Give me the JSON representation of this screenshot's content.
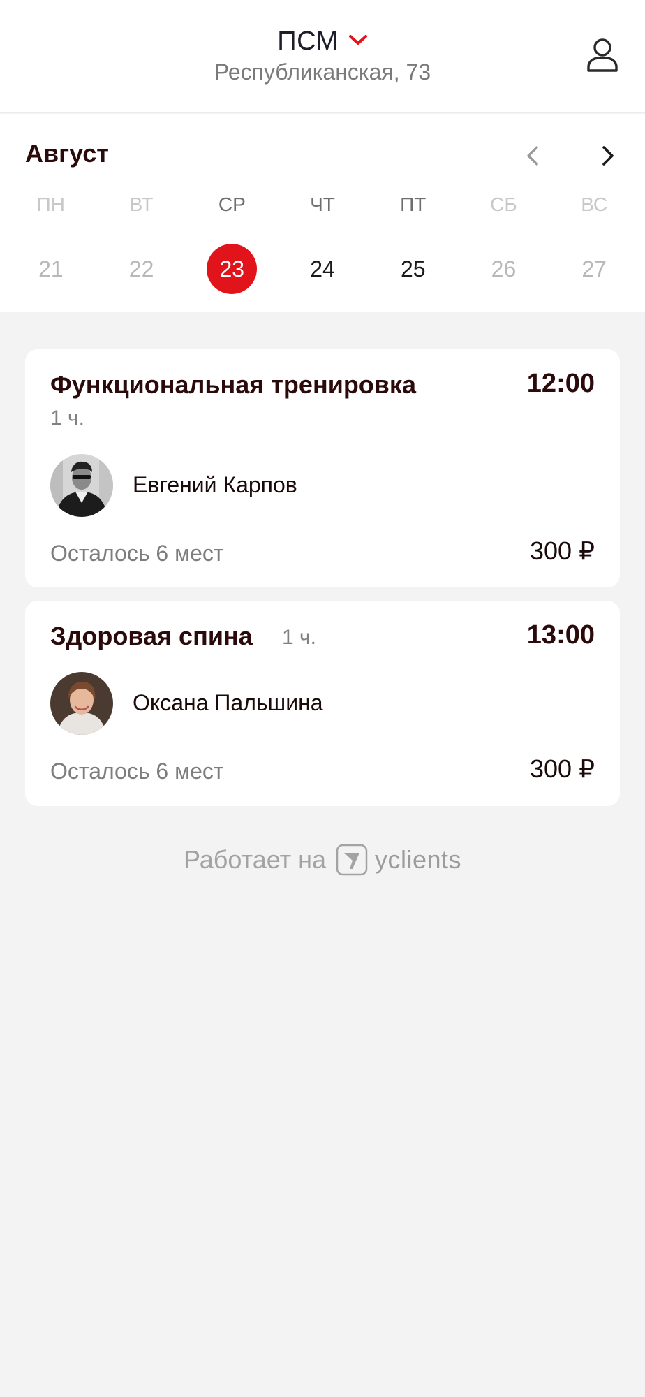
{
  "header": {
    "club_name": "ПСМ",
    "address": "Республиканская, 73",
    "icons": {
      "dropdown": "chevron-down-icon",
      "profile": "user-icon"
    },
    "accent_color": "#e2141b"
  },
  "calendar": {
    "month": "Август",
    "weekdays": [
      "ПН",
      "ВТ",
      "СР",
      "ЧТ",
      "ПТ",
      "СБ",
      "ВС"
    ],
    "dates": [
      "21",
      "22",
      "23",
      "24",
      "25",
      "26",
      "27"
    ],
    "selected_date": "23",
    "available_dates": [
      "23",
      "24",
      "25"
    ],
    "icons": {
      "prev": "chevron-left-icon",
      "next": "chevron-right-icon"
    }
  },
  "sessions": [
    {
      "title": "Функциональная тренировка",
      "duration": "1 ч.",
      "time": "12:00",
      "trainer": "Евгений Карпов",
      "seats": "Осталось 6 мест",
      "price": "300 ₽"
    },
    {
      "title": "Здоровая спина",
      "duration": "1 ч.",
      "time": "13:00",
      "trainer": "Оксана Пальшина",
      "seats": "Осталось 6 мест",
      "price": "300 ₽"
    }
  ],
  "footer": {
    "powered_by": "Работает на",
    "brand": "yclients"
  }
}
